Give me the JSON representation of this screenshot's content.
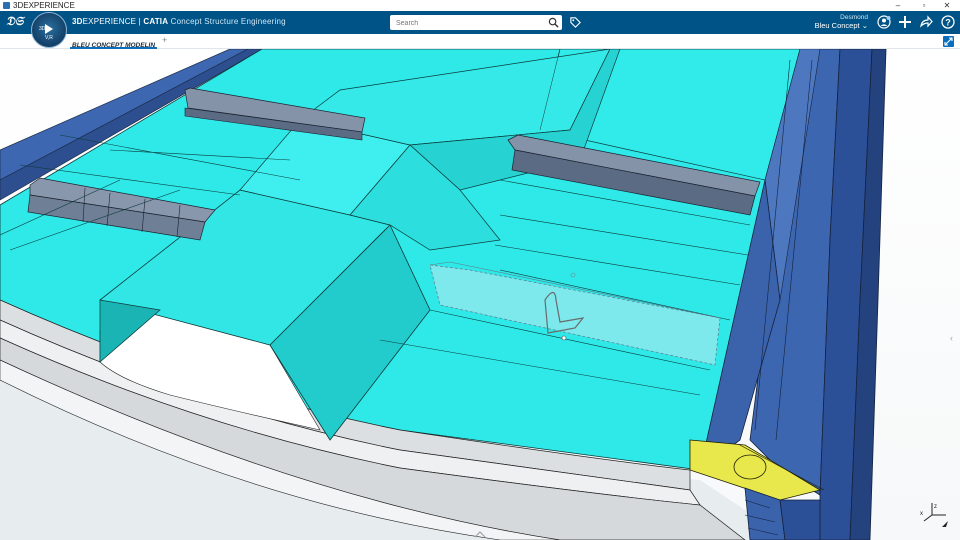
{
  "os": {
    "title": "3DEXPERIENCE",
    "min": "–",
    "max": "▫",
    "close": "✕"
  },
  "topbar": {
    "brand_bold": "3D",
    "brand_rest": "EXPERIENCE | ",
    "brand_product": "CATIA",
    "brand_app": " Concept Structure Engineering",
    "compass_label": "V,R"
  },
  "search": {
    "placeholder": "Search",
    "value": ""
  },
  "user": {
    "name": "Desmond",
    "space": "Bleu Concept"
  },
  "tabs": [
    {
      "label": "BLEU CONCEPT MODELIN",
      "active": true
    }
  ],
  "icons": {
    "logo": "ds-logo-icon",
    "search": "search-icon",
    "tag": "tag-icon",
    "profile": "user-profile-icon",
    "add": "plus-icon",
    "share": "share-icon",
    "help": "help-icon",
    "expand": "expand-icon",
    "triad": "axis-triad-icon"
  },
  "colors": {
    "topbar": "#005386",
    "cyan": "#2ee6e6",
    "blue": "#3660a8",
    "yellow": "#e6e64a"
  }
}
